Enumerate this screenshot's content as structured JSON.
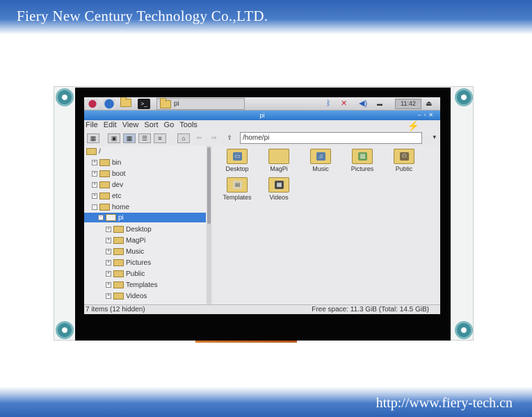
{
  "banner": {
    "company": "Fiery New Century Technology Co.,LTD.",
    "url": "http://www.fiery-tech.cn"
  },
  "taskbar": {
    "task_label": "pi",
    "clock": "11:42"
  },
  "window": {
    "title": "pi",
    "menu": [
      "File",
      "Edit",
      "View",
      "Sort",
      "Go",
      "Tools"
    ],
    "path": "/home/pi"
  },
  "tree": {
    "root": "/",
    "items": [
      {
        "label": "bin",
        "expander": "+"
      },
      {
        "label": "boot",
        "expander": "+"
      },
      {
        "label": "dev",
        "expander": "+"
      },
      {
        "label": "etc",
        "expander": "+"
      },
      {
        "label": "home",
        "expander": "-"
      },
      {
        "label": "pi",
        "expander": "-"
      },
      {
        "label": "Desktop",
        "expander": "+"
      },
      {
        "label": "MagPi",
        "expander": "+"
      },
      {
        "label": "Music",
        "expander": "+"
      },
      {
        "label": "Pictures",
        "expander": "+"
      },
      {
        "label": "Public",
        "expander": "+"
      },
      {
        "label": "Templates",
        "expander": "+"
      },
      {
        "label": "Videos",
        "expander": "+"
      }
    ]
  },
  "main": {
    "icons": [
      {
        "label": "Desktop",
        "emblem": "▭"
      },
      {
        "label": "MagPi",
        "emblem": ""
      },
      {
        "label": "Music",
        "emblem": "♫"
      },
      {
        "label": "Pictures",
        "emblem": "▨"
      },
      {
        "label": "Public",
        "emblem": "⚇"
      },
      {
        "label": "Templates",
        "emblem": "▤"
      },
      {
        "label": "Videos",
        "emblem": "▦"
      }
    ]
  },
  "status": {
    "items": "7 items (12 hidden)",
    "free_space": "Free space: 11.3 GiB (Total: 14.5 GiB)"
  }
}
